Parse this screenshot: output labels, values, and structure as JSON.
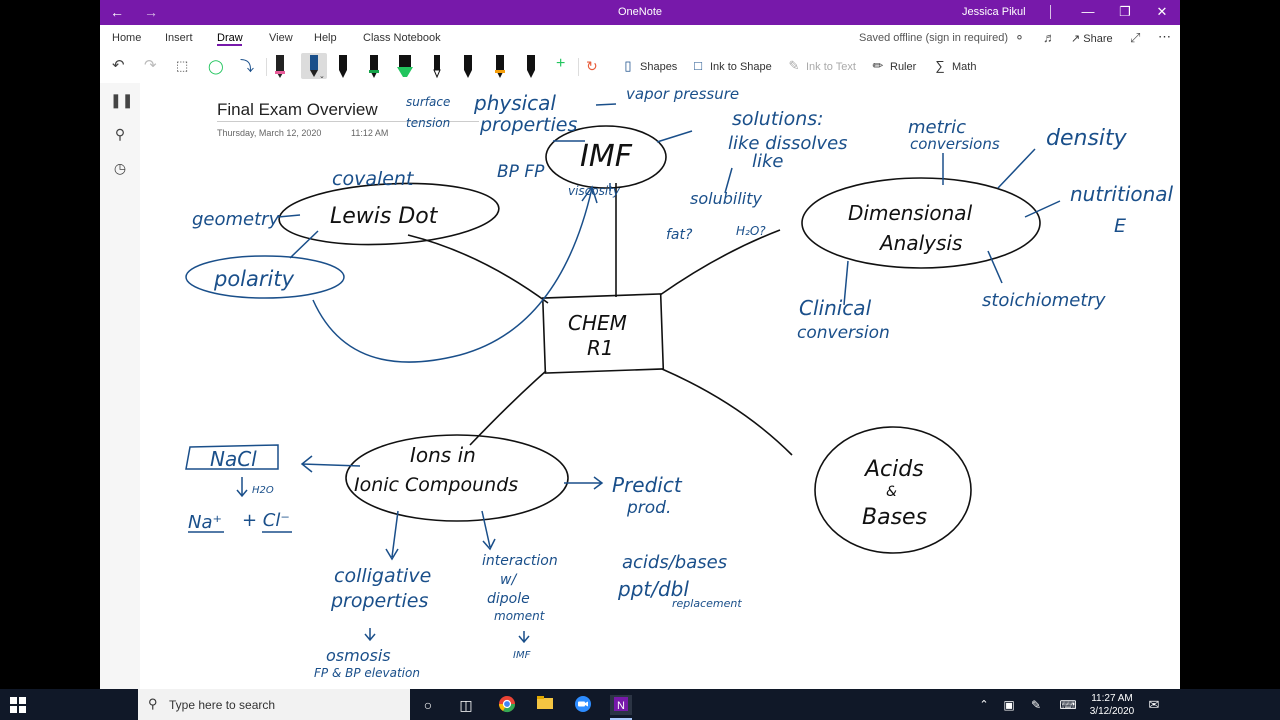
{
  "window": {
    "title": "OneNote",
    "user": "Jessica Pikul"
  },
  "colors": {
    "accent": "#7719aa",
    "ink_blue": "#1a4f8a",
    "ink_black": "#111111",
    "highlighter_green": "#22c55e",
    "taskbar": "#101828"
  },
  "ribbon": {
    "tabs": [
      "Home",
      "Insert",
      "Draw",
      "View",
      "Help",
      "Class Notebook"
    ],
    "active_tab": "Draw",
    "status": "Saved offline (sign in required)",
    "share_label": "Share",
    "tools": {
      "shapes": "Shapes",
      "ink_to_shape": "Ink to Shape",
      "ink_to_text": "Ink to Text",
      "ruler": "Ruler",
      "math": "Math"
    }
  },
  "page": {
    "title": "Final Exam Overview",
    "date": "Thursday, March 12, 2020",
    "time": "11:12 AM"
  },
  "ink_notes": {
    "imf": "IMF",
    "chem_line1": "CHEM",
    "chem_line2": "R1",
    "lewis_dot": "Lewis Dot",
    "covalent": "covalent",
    "geometry": "geometry",
    "polarity": "polarity",
    "physical": "physical",
    "vapor_pressure": "vapor pressure",
    "surface": "surface",
    "tension": "tension",
    "properties": "properties",
    "bp_fp": "BP  FP",
    "viscosity": "viscosity",
    "solutions1": "solutions:",
    "solutions2": "like dissolves",
    "solutions3": "like",
    "solubility": "solubility",
    "fat": "fat?",
    "h2o": "H₂O?",
    "metric1": "metric",
    "metric2": "conversions",
    "density": "density",
    "nutritional1": "nutritional",
    "nutritional2": "E",
    "da1": "Dimensional",
    "da2": "Analysis",
    "clinical1": "Clinical",
    "clinical2": "conversion",
    "stoich": "stoichiometry",
    "ions1": "Ions in",
    "ions2": "Ionic Compounds",
    "nacl": "NaCl",
    "h2o_sub": "H2O",
    "na": "Na⁺",
    "cl": "+ Cl⁻",
    "predict1": "Predict",
    "predict2": "prod.",
    "ab1": "acids/bases",
    "ab2": "ppt/dbl",
    "ab3": "replacement",
    "colligative1": "colligative",
    "colligative2": "properties",
    "osmosis": "osmosis",
    "fpbp": "FP & BP elevation",
    "interaction1": "interaction",
    "interaction2": "w/",
    "interaction3": "dipole",
    "interaction4": "moment",
    "imf_small": "IMF",
    "acids1": "Acids",
    "acids2": "&",
    "acids3": "Bases"
  },
  "taskbar": {
    "search_placeholder": "Type here to search",
    "time": "11:27 AM",
    "date": "3/12/2020"
  }
}
